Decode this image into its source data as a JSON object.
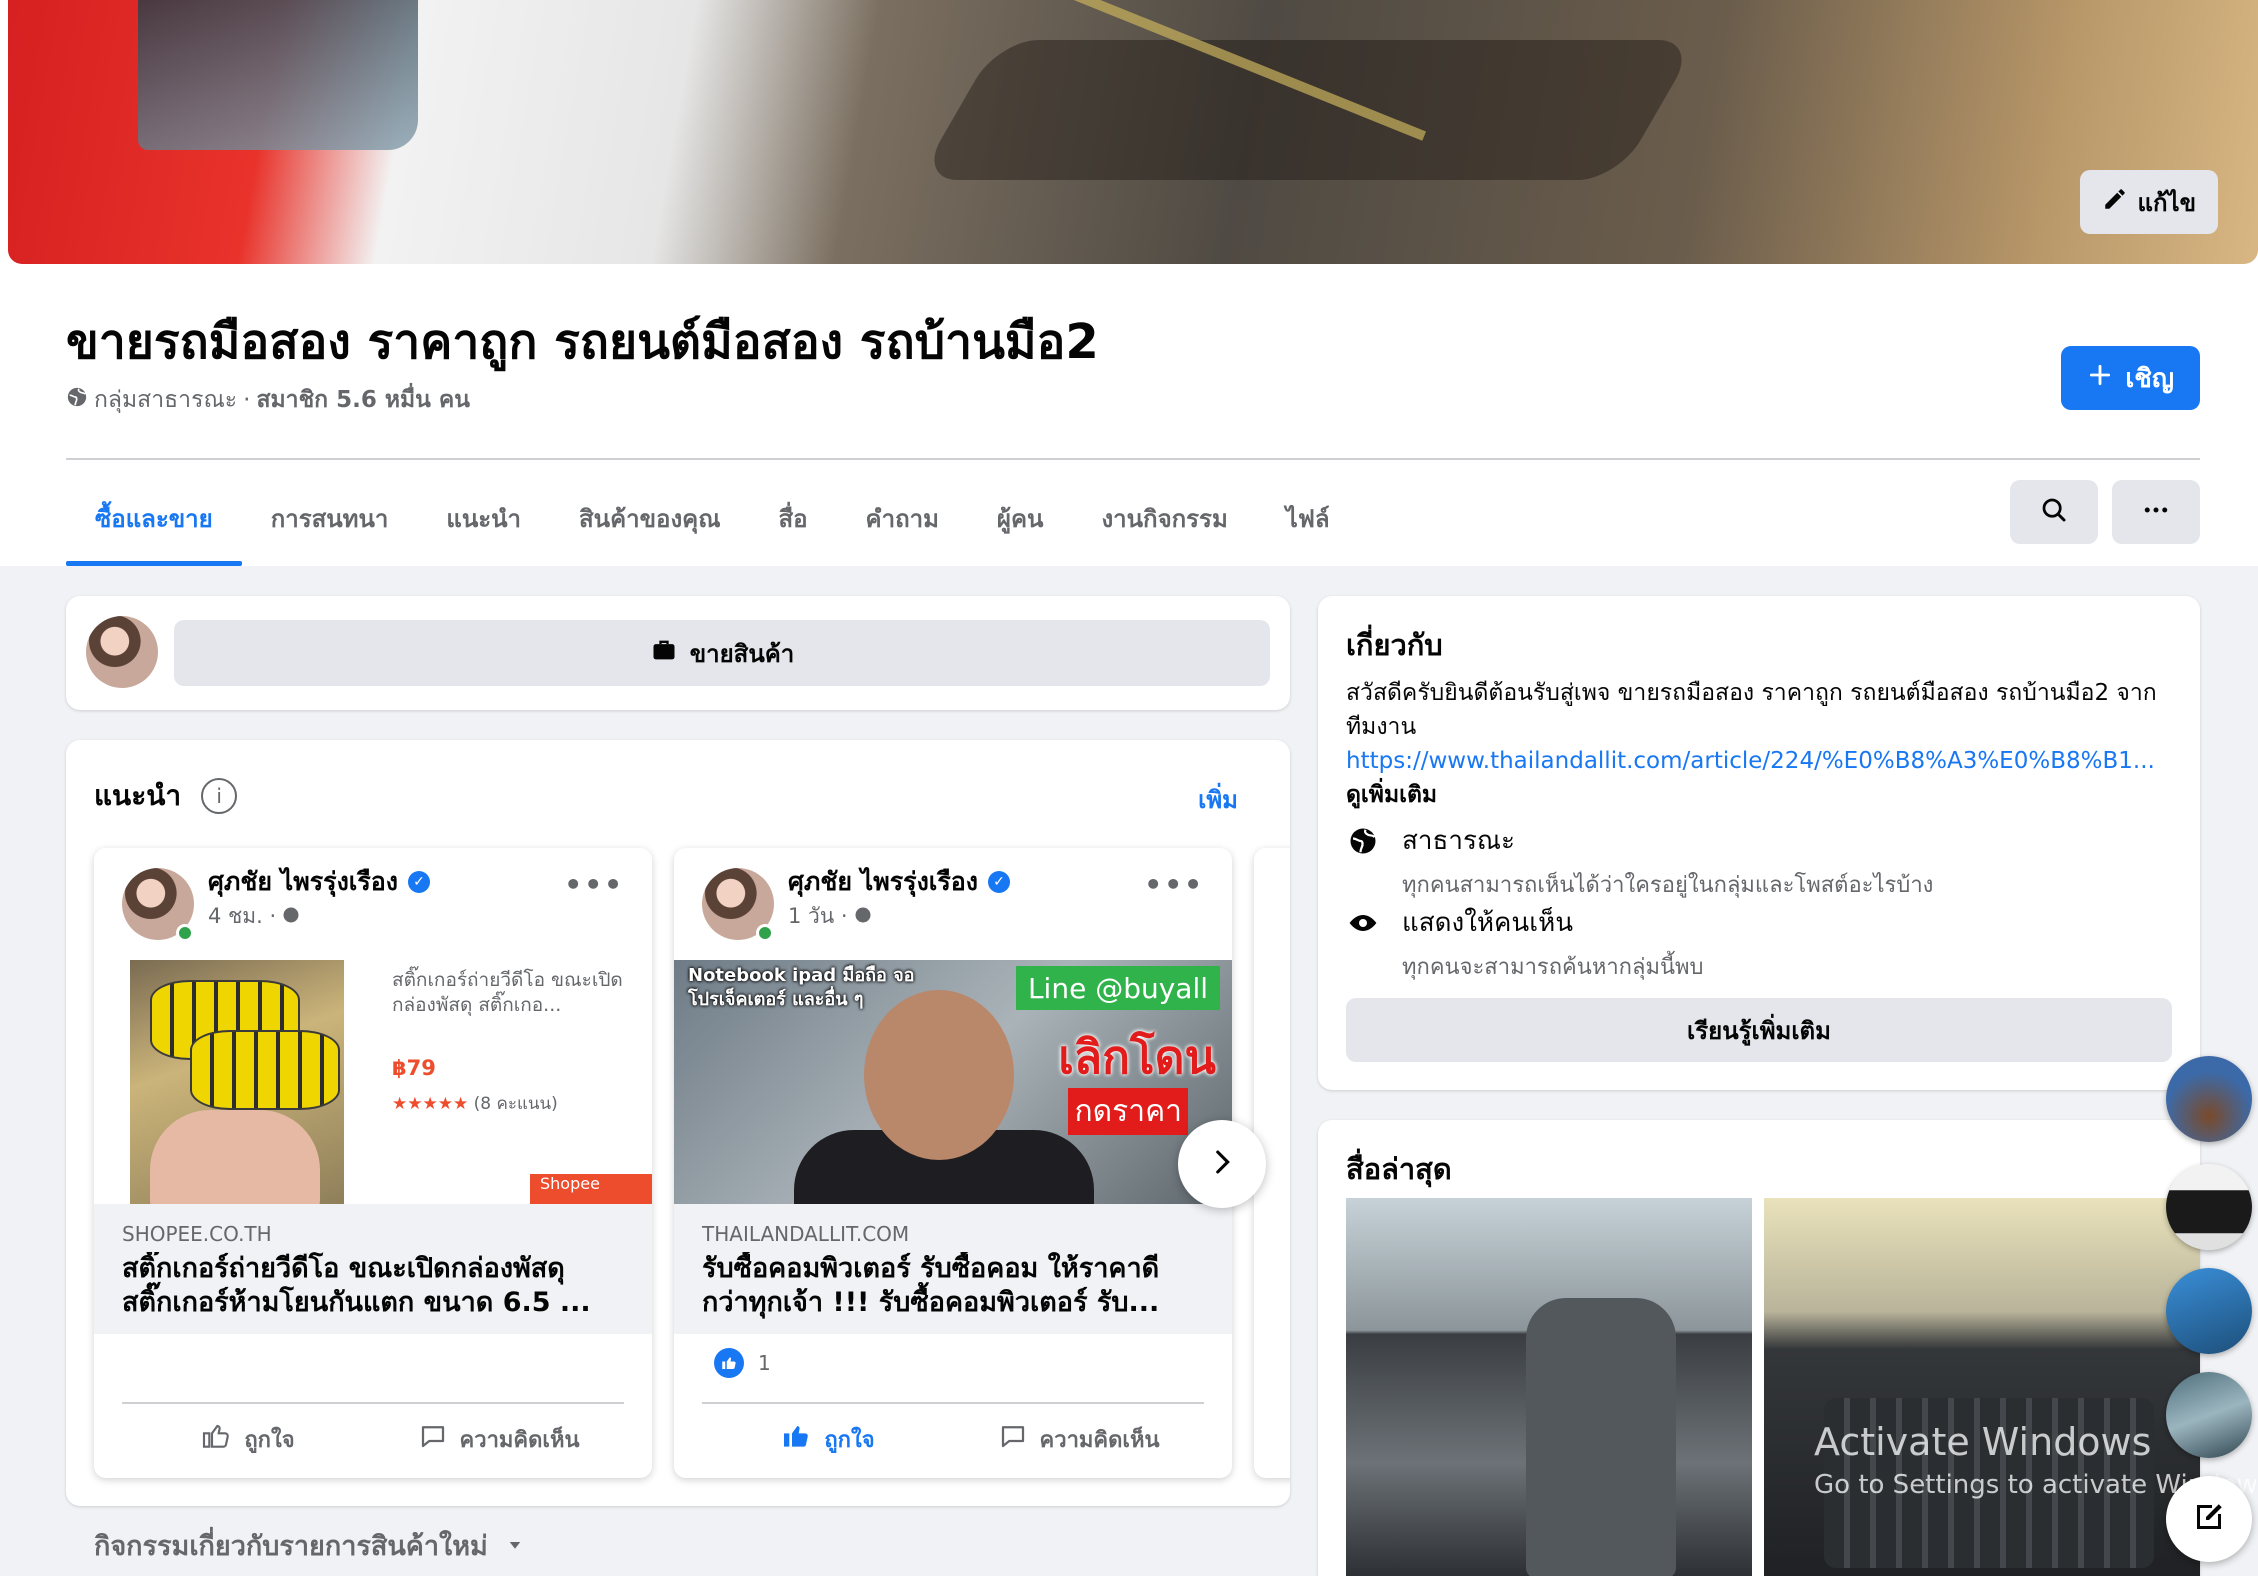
{
  "header": {
    "edit_cover_label": "แก้ไข",
    "group_title": "ขายรถมือสอง ราคาถูก รถยนต์มือสอง รถบ้านมือ2",
    "privacy": "กลุ่มสาธารณะ",
    "separator": "·",
    "members": "สมาชิก 5.6 หมื่น คน",
    "invite_label": "เชิญ"
  },
  "tabs": [
    {
      "label": "ซื้อและขาย",
      "active": true
    },
    {
      "label": "การสนทนา"
    },
    {
      "label": "แนะนำ"
    },
    {
      "label": "สินค้าของคุณ"
    },
    {
      "label": "สื่อ"
    },
    {
      "label": "คำถาม"
    },
    {
      "label": "ผู้คน"
    },
    {
      "label": "งานกิจกรรม"
    },
    {
      "label": "ไฟล์"
    }
  ],
  "sell": {
    "button_label": "ขายสินค้า"
  },
  "recommended": {
    "title": "แนะนำ",
    "more_label": "เพิ่ม",
    "posts": [
      {
        "author": "ศุภชัย ไพรรุ่งเรือง",
        "time": "4 ชม. ·",
        "product_text": "สติ๊กเกอร์ถ่ายวีดีโอ ขณะเปิดกล่องพัสดุ สติ๊กเกอ...",
        "price": "฿79",
        "rating_stars": "★★★★★",
        "rating_count": "(8 คะแนน)",
        "shop_badge": "Shopee",
        "domain": "SHOPEE.CO.TH",
        "link_title": "สติ๊กเกอร์ถ่ายวีดีโอ ขณะเปิดกล่องพัสดุ สติ๊กเกอร์ห้ามโยนกันแตก ขนาด 6.5 ...",
        "like_count": "",
        "like_label": "ถูกใจ",
        "comment_label": "ความคิดเห็น"
      },
      {
        "author": "ศุภชัย ไพรรุ่งเรือง",
        "time": "1 วัน ·",
        "overlay_text_1": "Notebook ipad มือถือ จอ",
        "overlay_text_2": "โปรเจ็คเตอร์ และอื่น ๆ",
        "line_badge": "Line @buyall",
        "promo_text": "เลิกโดน",
        "promo_text_2": "กดราคา",
        "domain": "THAILANDALLIT.COM",
        "link_title": "รับซื้อคอมพิวเตอร์ รับซื้อคอม ให้ราคาดีกว่าทุกเจ้า !!! รับซื้อคอมพิวเตอร์ รับ...",
        "like_count": "1",
        "like_label": "ถูกใจ",
        "comment_label": "ความคิดเห็น"
      }
    ]
  },
  "activity_label": "กิจกรรมเกี่ยวกับรายการสินค้าใหม่",
  "about": {
    "title": "เกี่ยวกับ",
    "description": "สวัสดีครับยินดีต้อนรับสู่เพจ ขายรถมือสอง ราคาถูก รถยนต์มือสอง รถบ้านมือ2 จากทีมงาน",
    "url": "https://www.thailandallit.com/article/224/%E0%B8%A3%E0%B8%B1...",
    "see_more": " ดูเพิ่มเติม",
    "public_title": "สาธารณะ",
    "public_desc": "ทุกคนสามารถเห็นได้ว่าใครอยู่ในกลุ่มและโพสต์อะไรบ้าง",
    "visible_title": "แสดงให้คนเห็น",
    "visible_desc": "ทุกคนจะสามารถค้นหากลุ่มนี้พบ",
    "learn_more": "เรียนรู้เพิ่มเติม"
  },
  "media": {
    "title": "สื่อล่าสุด"
  },
  "watermark": {
    "line1": "Activate Windows",
    "line2": "Go to Settings to activate Windows."
  },
  "colors": {
    "accent": "#1877f2",
    "bg": "#f0f2f5",
    "muted": "#65676b",
    "shopee": "#ee4d2d"
  }
}
